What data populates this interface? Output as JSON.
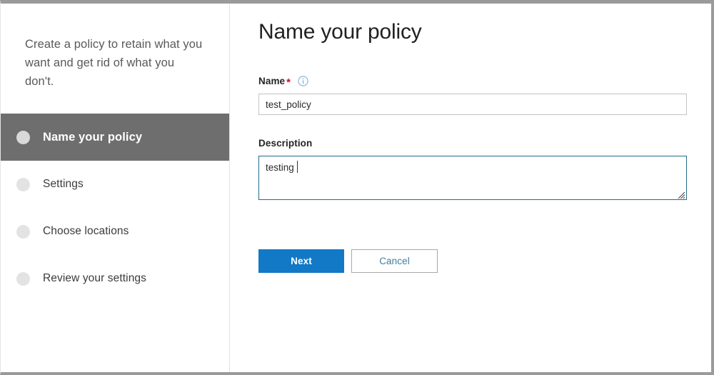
{
  "sidebar": {
    "intro_text": "Create a policy to retain what you want and get rid of what you don't.",
    "items": [
      {
        "label": "Name your policy",
        "state": "active",
        "bullet_icon": "circle-filled-icon"
      },
      {
        "label": "Settings",
        "state": "inactive",
        "bullet_icon": "circle-filled-icon"
      },
      {
        "label": "Choose locations",
        "state": "inactive",
        "bullet_icon": "circle-filled-icon"
      },
      {
        "label": "Review your settings",
        "state": "inactive",
        "bullet_icon": "circle-filled-icon"
      }
    ]
  },
  "main": {
    "page_title": "Name your policy",
    "name_field": {
      "label": "Name",
      "required_marker": "*",
      "info_icon": "info-circle-icon",
      "value": "test_policy",
      "placeholder": ""
    },
    "description_field": {
      "label": "Description",
      "value": "testing",
      "placeholder": ""
    },
    "actions": {
      "next_label": "Next",
      "cancel_label": "Cancel"
    }
  },
  "colors": {
    "accent_blue": "#1279c6",
    "active_nav_gray": "#6e6e6e",
    "focus_border": "#1f6e8c",
    "required_red": "#c8102e",
    "window_border": "#9a9a9a",
    "cancel_text": "#3f7fa0"
  }
}
